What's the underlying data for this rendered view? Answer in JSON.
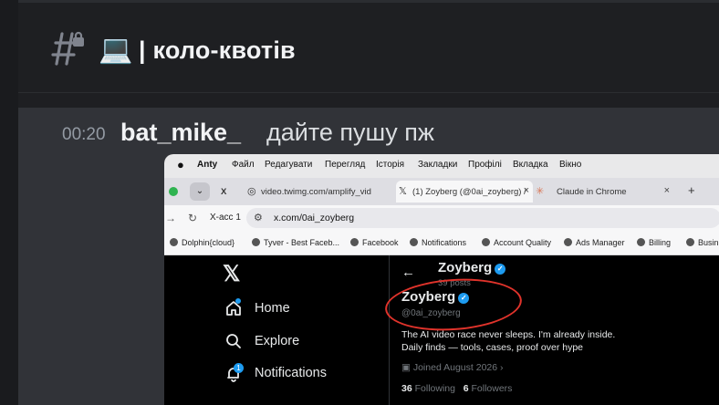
{
  "channel": {
    "emoji": "💻",
    "separator": "|",
    "name": "коло-квотів"
  },
  "message": {
    "time": "00:20",
    "author": "bat_mike_",
    "text": "дайте пушу пж"
  },
  "screenshot": {
    "menubar": {
      "app": "Anty",
      "items": [
        "Файл",
        "Редагувати",
        "Перегляд",
        "Історія",
        "Закладки",
        "Профілі",
        "Вкладка",
        "Вікно"
      ]
    },
    "tabs": [
      {
        "label": "video.twimg.com/amplify_vid"
      },
      {
        "label": "(1) Zoyberg (@0ai_zoyberg) /"
      },
      {
        "label": "Claude in Chrome"
      }
    ],
    "tab_x_icon": "X",
    "new_tab": "+",
    "profile_label": "X-acc 1",
    "url": "x.com/0ai_zoyberg",
    "bookmarks": [
      "Dolphin{cloud}",
      "Tyver - Best Faceb...",
      "Facebook",
      "Notifications",
      "Account Quality",
      "Ads Manager",
      "Billing",
      "Busin"
    ],
    "twitter": {
      "logo": "𝕏",
      "nav": [
        {
          "label": "Home",
          "icon": "home-icon"
        },
        {
          "label": "Explore",
          "icon": "search-icon"
        },
        {
          "label": "Notifications",
          "icon": "bell-icon",
          "badge": "1"
        }
      ],
      "header_name": "Zoyberg",
      "header_posts": "39 posts",
      "profile_name": "Zoyberg",
      "handle": "@0ai_zoyberg",
      "bio_line1": "The AI video race never sleeps. I'm already inside.",
      "bio_line2": "Daily finds — tools, cases, proof over hype",
      "joined": "Joined August 2026",
      "following_count": "36",
      "following_label": "Following",
      "followers_count": "6",
      "followers_label": "Followers"
    }
  }
}
